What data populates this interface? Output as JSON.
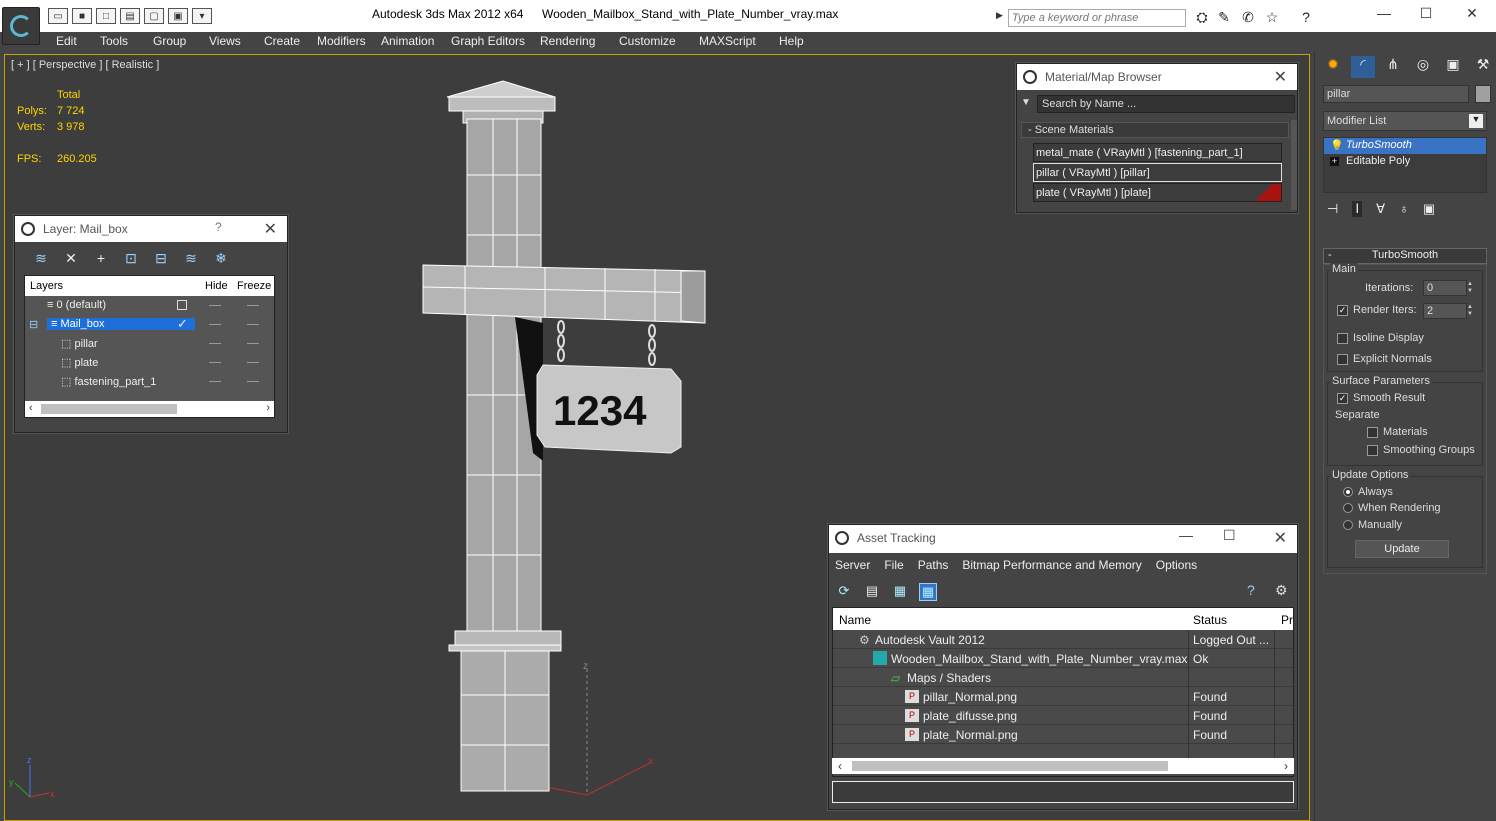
{
  "titlebar": {
    "app_title": "Autodesk 3ds Max  2012 x64",
    "file_title": "Wooden_Mailbox_Stand_with_Plate_Number_vray.max",
    "search_placeholder": "Type a keyword or phrase",
    "minimize": "—",
    "maximize": "☐",
    "close": "✕"
  },
  "menu": [
    "Edit",
    "Tools",
    "Group",
    "Views",
    "Create",
    "Modifiers",
    "Animation",
    "Graph Editors",
    "Rendering",
    "Customize",
    "MAXScript",
    "Help"
  ],
  "viewport": {
    "label": "[ + ] [ Perspective ] [ Realistic ]",
    "stats_header": "Total",
    "polys_label": "Polys:",
    "polys": "7 724",
    "verts_label": "Verts:",
    "verts": "3 978",
    "fps_label": "FPS:",
    "fps": "260.205",
    "plate_number": "1234",
    "axis_labels": {
      "x": "x",
      "y": "y",
      "z": "z"
    }
  },
  "layer_panel": {
    "title": "Layer: Mail_box",
    "help": "?",
    "close": "✕",
    "col_layers": "Layers",
    "col_hide": "Hide",
    "col_freeze": "Freeze",
    "rows": [
      {
        "name": "0 (default)"
      },
      {
        "name": "Mail_box"
      },
      {
        "name": "pillar"
      },
      {
        "name": "plate"
      },
      {
        "name": "fastening_part_1"
      }
    ]
  },
  "material_browser": {
    "title": "Material/Map Browser",
    "close": "✕",
    "search_placeholder": "Search by Name ...",
    "section": "- Scene Materials",
    "items": [
      {
        "label": "metal_mate  ( VRayMtl )  [fastening_part_1]"
      },
      {
        "label": "pillar  ( VRayMtl )  [pillar]"
      },
      {
        "label": "plate  ( VRayMtl )  [plate]"
      }
    ]
  },
  "asset_tracking": {
    "title": "Asset Tracking",
    "menu": [
      "Server",
      "File",
      "Paths",
      "Bitmap Performance and Memory",
      "Options"
    ],
    "col_name": "Name",
    "col_status": "Status",
    "col_extra": "Pro",
    "rows": [
      {
        "name": "Autodesk Vault 2012",
        "status": "Logged Out ..."
      },
      {
        "name": "Wooden_Mailbox_Stand_with_Plate_Number_vray.max",
        "status": "Ok"
      },
      {
        "name": "Maps / Shaders",
        "status": ""
      },
      {
        "name": "pillar_Normal.png",
        "status": "Found"
      },
      {
        "name": "plate_difusse.png",
        "status": "Found"
      },
      {
        "name": "plate_Normal.png",
        "status": "Found"
      }
    ]
  },
  "command_panel": {
    "object_name": "pillar",
    "modifier_list": "Modifier List",
    "stack": [
      "TurboSmooth",
      "Editable Poly"
    ],
    "rollout_title": "TurboSmooth",
    "main_group": "Main",
    "iterations_label": "Iterations:",
    "iterations": "0",
    "render_iters_label": "Render Iters:",
    "render_iters": "2",
    "isoline": "Isoline Display",
    "explicit_normals": "Explicit Normals",
    "surface_group": "Surface Parameters",
    "smooth_result": "Smooth Result",
    "separate": "Separate",
    "materials": "Materials",
    "smoothing_groups": "Smoothing Groups",
    "update_group": "Update Options",
    "always": "Always",
    "when_rendering": "When Rendering",
    "manually": "Manually",
    "update_button": "Update"
  }
}
